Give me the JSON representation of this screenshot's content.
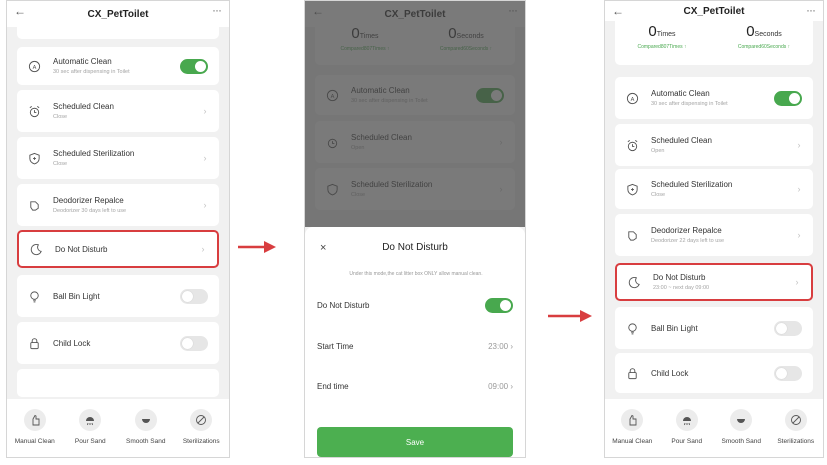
{
  "app": {
    "title": "CX_PetToilet"
  },
  "rows": {
    "automatic_clean": {
      "title": "Automatic Clean",
      "sub": "30 sec after dispensing in Toilet"
    },
    "scheduled_clean": {
      "title": "Scheduled Clean",
      "sub_before": "Close",
      "sub_after": "Open"
    },
    "scheduled_sterilization": {
      "title": "Scheduled Sterilization",
      "sub": "Close"
    },
    "deodorizer_replace": {
      "title": "Deodorizer Repalce",
      "sub_before": "Deodorizer 30 days left to use",
      "sub_after": "Deodorizer 22 days left to use"
    },
    "do_not_disturb": {
      "title": "Do Not Disturb",
      "sub_after": "23:00 ~ next day 09:00"
    },
    "ball_bin_light": {
      "title": "Ball Bin Light"
    },
    "child_lock": {
      "title": "Child Lock"
    }
  },
  "stats": {
    "times_value": "0",
    "times_unit": "Times",
    "times_sub": "Compared807Times",
    "seconds_value": "0",
    "seconds_unit": "Seconds",
    "seconds_sub": "Compared60Seconds"
  },
  "tabs": [
    {
      "label": "Manual Clean",
      "icon": "manual-clean-icon"
    },
    {
      "label": "Pour Sand",
      "icon": "pour-sand-icon"
    },
    {
      "label": "Smooth Sand",
      "icon": "smooth-sand-icon"
    },
    {
      "label": "Sterilizations",
      "icon": "sterilization-icon"
    }
  ],
  "modal": {
    "close": "×",
    "title": "Do Not  Disturb",
    "description": "Under this mode,the cat litter box ONLY allow manual clean.",
    "dnd_label": "Do Not Disturb",
    "start_label": "Start Time",
    "start_value": "23:00",
    "end_label": "End time",
    "end_value": "09:00",
    "save": "Save"
  },
  "colors": {
    "accent": "#48a84e",
    "highlight": "#d83d3f"
  }
}
